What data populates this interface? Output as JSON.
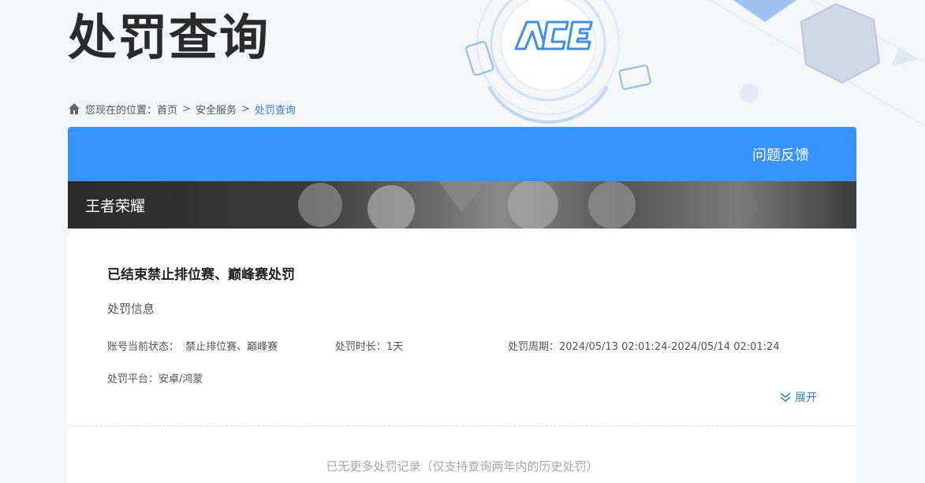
{
  "header": {
    "page_title": "处罚查询"
  },
  "breadcrumb": {
    "prefix": "您现在的位置：",
    "items": [
      "首页",
      "安全服务",
      "处罚查询"
    ],
    "separator": ">"
  },
  "toolbar": {
    "feedback_label": "问题反馈"
  },
  "game": {
    "name": "王者荣耀"
  },
  "record": {
    "title": "已结束禁止排位赛、巅峰赛处罚",
    "section_label": "处罚信息",
    "status_label": "账号当前状态：",
    "status_value": "禁止排位赛、巅峰赛",
    "duration_label": "处罚时长：",
    "duration_value": "1天",
    "period_label": "处罚周期：",
    "period_value": "2024/05/13 02:01:24-2024/05/14 02:01:24",
    "platform_label": "处罚平台：",
    "platform_value": "安卓/鸿蒙",
    "expand_label": "展开"
  },
  "footer": {
    "no_more_text": "已无更多处罚记录（仅支持查询两年内的历史处罚）"
  },
  "colors": {
    "accent": "#3693ff",
    "link": "#2f7fd4",
    "background": "#f5f6f8"
  }
}
